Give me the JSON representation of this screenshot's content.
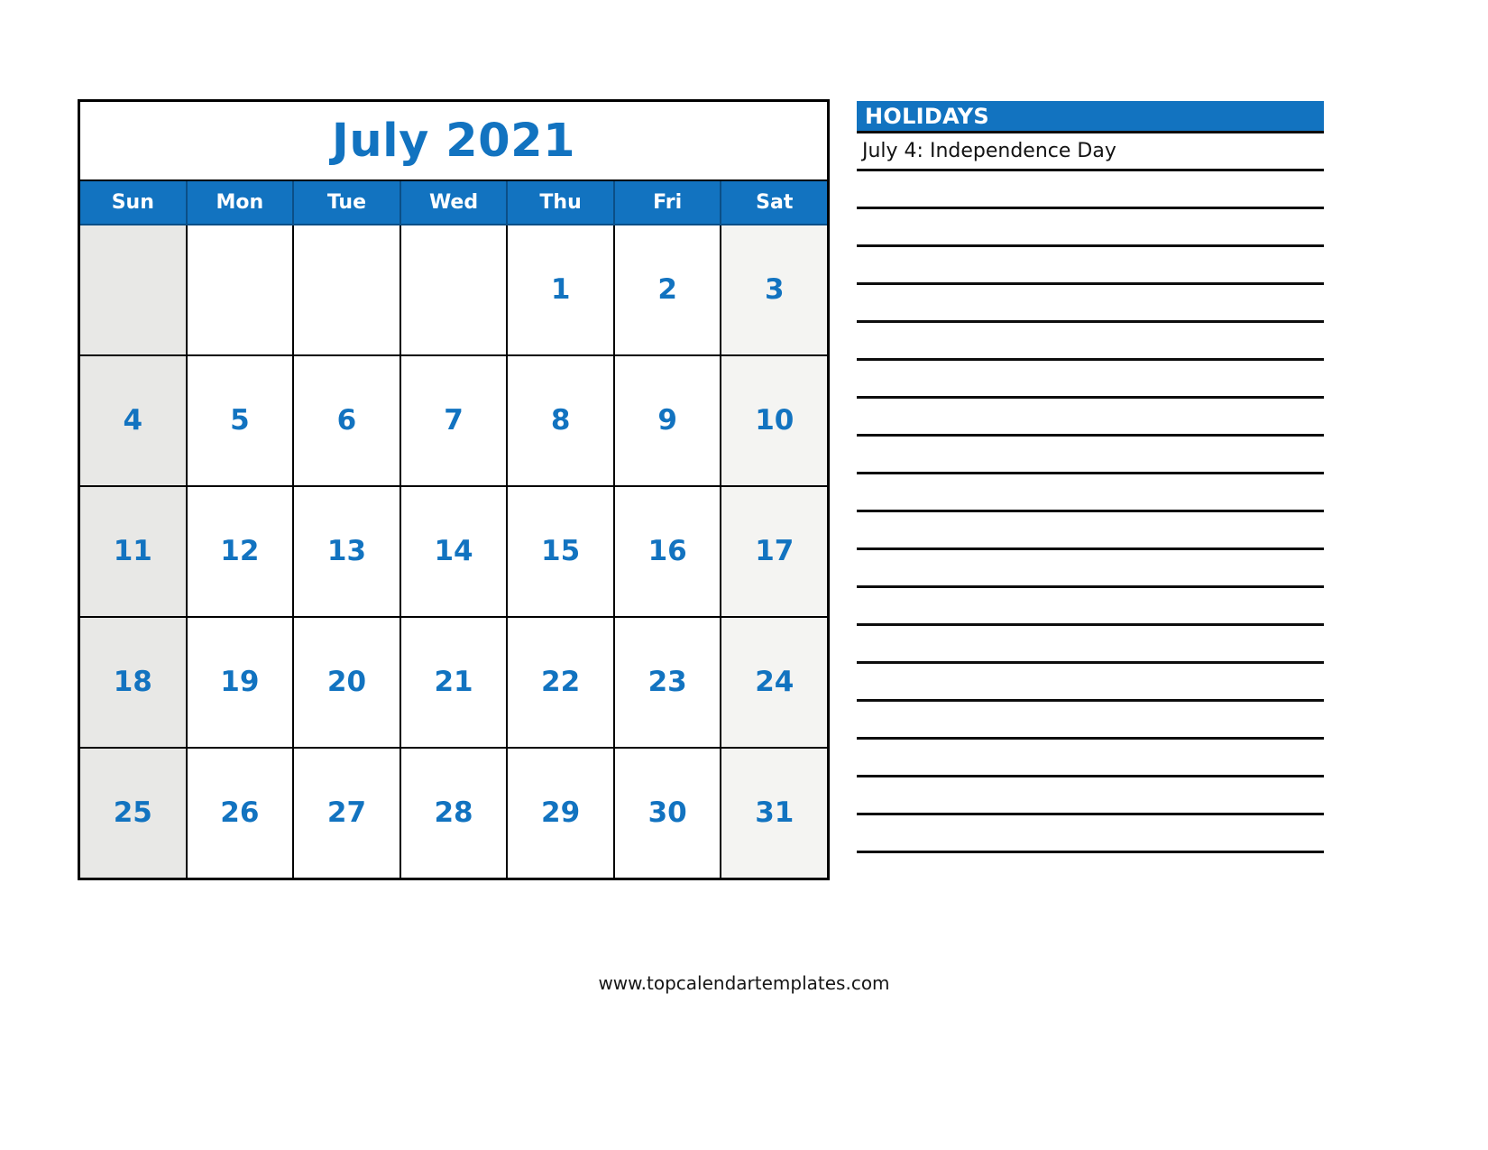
{
  "calendar": {
    "month_title": "July 2021",
    "weekdays": [
      "Sun",
      "Mon",
      "Tue",
      "Wed",
      "Thu",
      "Fri",
      "Sat"
    ],
    "weeks": [
      [
        "",
        "",
        "",
        "",
        "1",
        "2",
        "3"
      ],
      [
        "4",
        "5",
        "6",
        "7",
        "8",
        "9",
        "10"
      ],
      [
        "11",
        "12",
        "13",
        "14",
        "15",
        "16",
        "17"
      ],
      [
        "18",
        "19",
        "20",
        "21",
        "22",
        "23",
        "24"
      ],
      [
        "25",
        "26",
        "27",
        "28",
        "29",
        "30",
        "31"
      ]
    ]
  },
  "holidays": {
    "title": "HOLIDAYS",
    "entries": [
      "July 4: Independence Day",
      "",
      "",
      "",
      "",
      "",
      "",
      "",
      "",
      "",
      "",
      "",
      "",
      "",
      "",
      "",
      "",
      "",
      ""
    ]
  },
  "footer": {
    "url": "www.topcalendartemplates.com"
  },
  "colors": {
    "accent_blue": "#1273c0",
    "day_number_blue": "#1273c0",
    "sunday_fill": "#e8e8e6",
    "saturday_fill": "#f4f4f2",
    "border_black": "#000000",
    "header_text": "#ffffff"
  }
}
